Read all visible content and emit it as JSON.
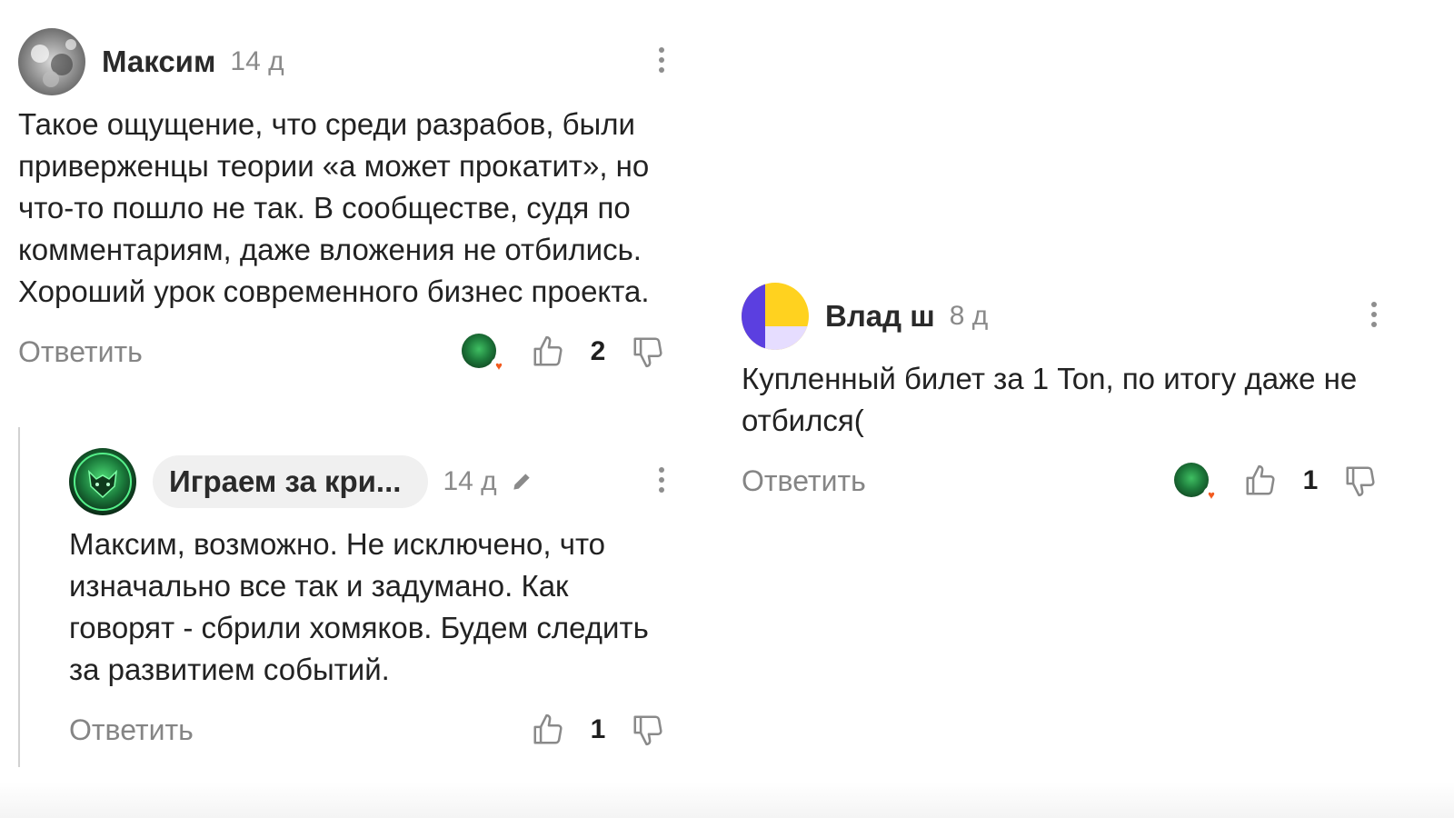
{
  "comments": [
    {
      "author": "Максим",
      "time": "14 д",
      "avatar_icon": "grayscale-photo-avatar",
      "text": "Такое ощущение, что среди разрабов, были приверженцы теории «а может прокатит», но что-то пошло не так. В сообществе, судя по комментариям, даже вложения не отбились. Хороший урок современного бизнес проекта.",
      "reply_label": "Ответить",
      "like_count": "2",
      "has_author_reaction": true
    },
    {
      "author": "Играем за кри...",
      "time": "14 д",
      "avatar_icon": "green-wolf-avatar",
      "text": "Максим, возможно. Не исключено, что изначально все так и задумано. Как говорят - сбрили хомяков. Будем следить за развитием событий.",
      "reply_label": "Ответить",
      "like_count": "1",
      "edited": true
    },
    {
      "author": "Влад ш",
      "time": "8 д",
      "avatar_icon": "purple-yellow-avatar",
      "text": "Купленный билет за 1 Ton, по итогу даже не отбился(",
      "reply_label": "Ответить",
      "like_count": "1",
      "has_author_reaction": true
    }
  ],
  "colors": {
    "muted_text": "#858585",
    "chip_bg": "#f0f0f0",
    "heart": "#f25a1e",
    "avatar_purple": "#5b3fe0",
    "avatar_yellow": "#ffd21f",
    "avatar_lilac": "#e6ddff"
  }
}
